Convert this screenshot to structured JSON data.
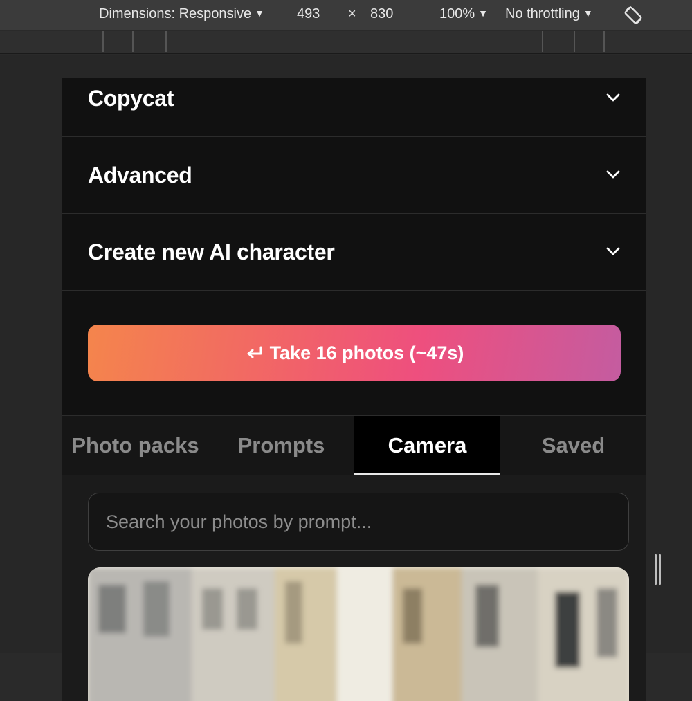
{
  "devtools": {
    "dimensions_label": "Dimensions: Responsive",
    "width": "493",
    "times": "×",
    "height": "830",
    "zoom": "100%",
    "throttling": "No throttling",
    "rotate_icon": "rotate-device-icon"
  },
  "accordion": {
    "items": [
      {
        "label": "Copycat",
        "icon": "chevron-down-icon"
      },
      {
        "label": "Advanced",
        "icon": "chevron-down-icon"
      },
      {
        "label": "Create new AI character",
        "icon": "chevron-down-icon"
      }
    ]
  },
  "cta": {
    "label": "Take 16 photos (~47s)",
    "icon": "enter-return-icon",
    "gradient": [
      "#f4854c",
      "#ee4f7e",
      "#c45ca0"
    ]
  },
  "tabs": {
    "items": [
      "Photo packs",
      "Prompts",
      "Camera",
      "Saved"
    ],
    "active": "Camera"
  },
  "search": {
    "placeholder": "Search your photos by prompt..."
  },
  "colors": {
    "page_bg": "#111111",
    "text": "#ffffff",
    "muted_tab": "#8a8a8a"
  }
}
